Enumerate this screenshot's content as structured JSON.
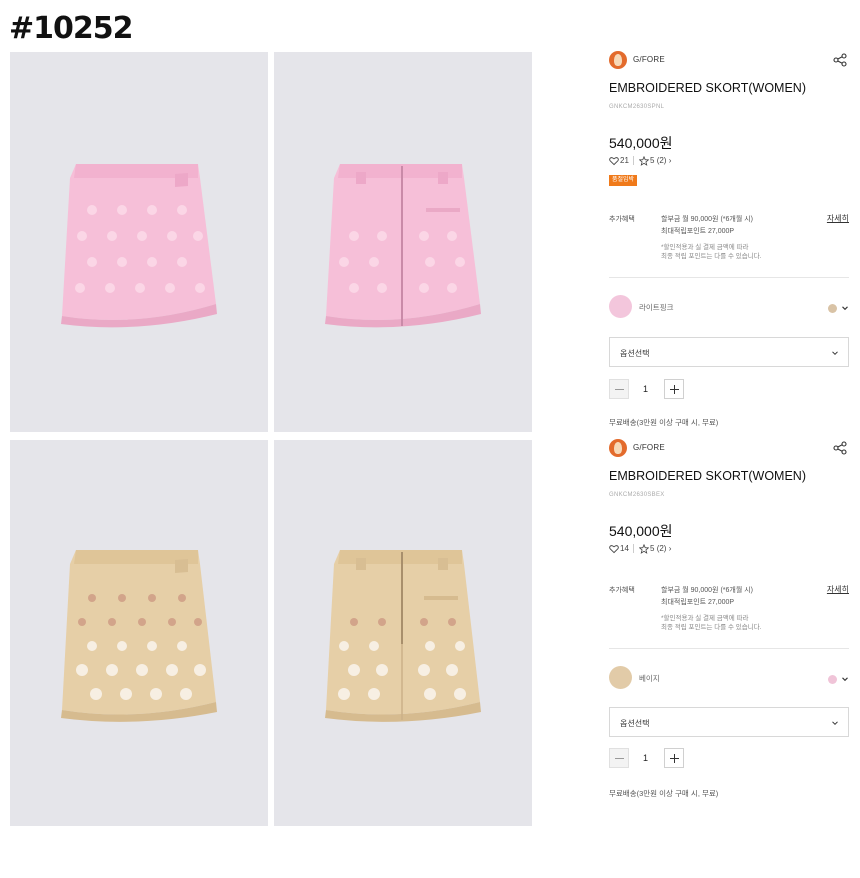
{
  "page_id": "#10252",
  "products": [
    {
      "brand": "G/FORE",
      "title": "EMBROIDERED SKORT(WOMEN)",
      "sku": "GNKCM2630SPNL",
      "price": "540,000원",
      "likes": "21",
      "rating": "5",
      "reviews": "(2)",
      "badge": "품절임박",
      "benefit_label": "추가혜택",
      "benefit_line1": "할부금 월 90,000원 (*6개월 시)",
      "benefit_line2": "최대적립포인트 27,000P",
      "benefit_note1": "*할인적용과 실 결제 금액에 따라",
      "benefit_note2": "최종 적립 포인트는 다를 수 있습니다.",
      "detail_link": "자세히",
      "color_name": "라이트핑크",
      "color_hex": "#f3c6dc",
      "alt_color_hex": "#d9c3a6",
      "option_label": "옵션선택",
      "quantity": "1",
      "shipping": "무료배송(3만원 이상 구매 시, 무료)"
    },
    {
      "brand": "G/FORE",
      "title": "EMBROIDERED SKORT(WOMEN)",
      "sku": "GNKCM2630SBEX",
      "price": "540,000원",
      "likes": "14",
      "rating": "5",
      "reviews": "(2)",
      "benefit_label": "추가혜택",
      "benefit_line1": "할부금 월 90,000원 (*6개월 시)",
      "benefit_line2": "최대적립포인트 27,000P",
      "benefit_note1": "*할인적용과 실 결제 금액에 따라",
      "benefit_note2": "최종 적립 포인트는 다를 수 있습니다.",
      "detail_link": "자세히",
      "color_name": "베이지",
      "color_hex": "#e2cba8",
      "alt_color_hex": "#f0c4d8",
      "option_label": "옵션선택",
      "quantity": "1",
      "shipping": "무료배송(3만원 이상 구매 시, 무료)"
    }
  ],
  "icons": {
    "share": "share-icon",
    "heart": "heart-icon",
    "star": "star-icon",
    "chevron": "chevron-down-icon"
  },
  "colors": {
    "photo_bg": "#e5e5ea",
    "skirt_pink": "#f6bfd8",
    "skirt_pink_shadow": "#eaa9c6",
    "skirt_beige": "#e6cfa7",
    "skirt_beige_shadow": "#d6bb8f",
    "badge": "#f07a1a",
    "brand_logo": "#e36b2c"
  }
}
